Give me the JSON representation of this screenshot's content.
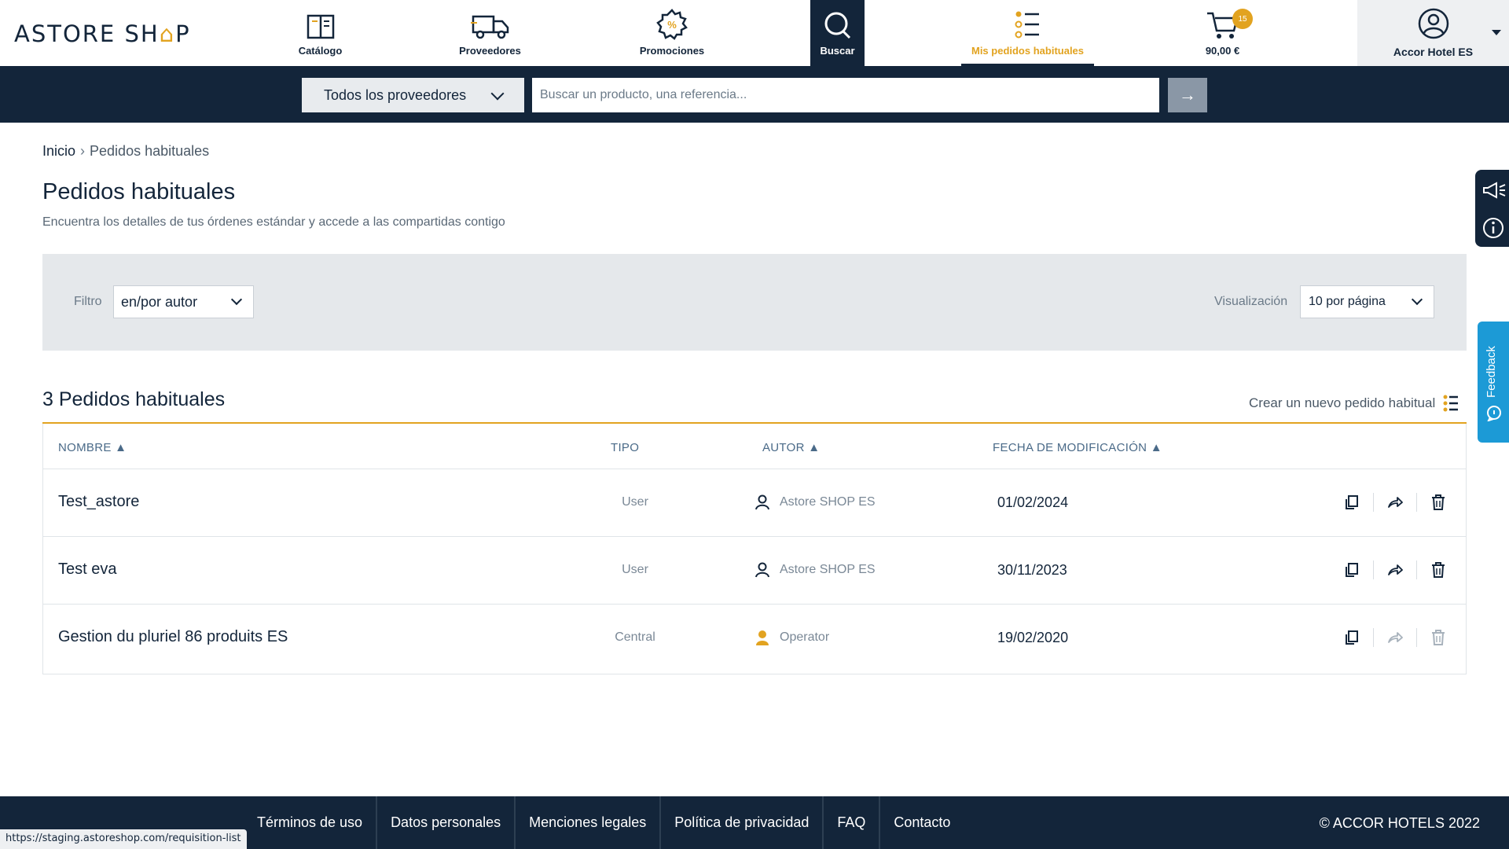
{
  "header": {
    "logo_text": "ASTORE SH",
    "logo_bag": "⌂",
    "logo_end": "P",
    "nav": {
      "catalog": "Catálogo",
      "providers": "Proveedores",
      "promotions": "Promociones",
      "search": "Buscar",
      "my_orders": "Mis pedidos habituales",
      "cart_total": "90,00 €",
      "cart_count": "15"
    },
    "account_name": "Accor Hotel ES"
  },
  "searchbar": {
    "provider_select": "Todos los proveedores",
    "placeholder": "Buscar un producto, una referencia...",
    "go_symbol": "→"
  },
  "breadcrumb": {
    "home": "Inicio",
    "separator": "›",
    "current": "Pedidos habituales"
  },
  "page": {
    "title": "Pedidos habituales",
    "subtitle": "Encuentra los detalles de tus órdenes estándar y accede a las compartidas contigo"
  },
  "filters": {
    "filter_label": "Filtro",
    "filter_value": "en/por autor",
    "view_label": "Visualización",
    "view_value": "10 por página"
  },
  "list": {
    "heading": "3 Pedidos habituales",
    "create_label": "Crear un nuevo pedido habitual",
    "columns": {
      "name": "NOMBRE ▲",
      "type": "TIPO",
      "author": "AUTOR ▲",
      "date": "FECHA DE MODIFICACIÓN ▲"
    },
    "rows": [
      {
        "name": "Test_astore",
        "type": "User",
        "author": "Astore SHOP ES",
        "date": "01/02/2024"
      },
      {
        "name": "Test eva",
        "type": "User",
        "author": "Astore SHOP ES",
        "date": "30/11/2023"
      },
      {
        "name": "Gestion du pluriel 86 produits ES",
        "type": "Central",
        "author": "Operator",
        "date": "19/02/2020"
      }
    ]
  },
  "feedback_label": "Feedback",
  "footer": {
    "links": [
      "Términos de uso",
      "Datos personales",
      "Menciones legales",
      "Política de privacidad",
      "FAQ",
      "Contacto"
    ],
    "copyright": "© ACCOR HOTELS 2022"
  },
  "status_url": "https://staging.astoreshop.com/requisition-list",
  "colors": {
    "navy": "#13253a",
    "accent": "#e2a320",
    "feedback": "#1c9ad6"
  }
}
